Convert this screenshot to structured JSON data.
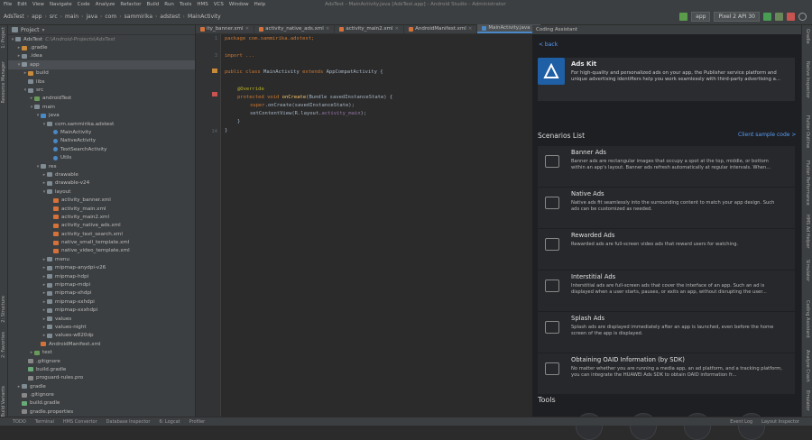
{
  "menubar": {
    "items": [
      "File",
      "Edit",
      "View",
      "Navigate",
      "Code",
      "Analyze",
      "Refactor",
      "Build",
      "Run",
      "Tools",
      "HMS",
      "VCS",
      "Window",
      "Help"
    ],
    "title": "AdsTest - MainActivity.java [AdsTest.app] - Android Studio - Administrator"
  },
  "breadcrumb": [
    "AdsTest",
    "app",
    "src",
    "main",
    "java",
    "com",
    "sammirika",
    "adstest",
    "MainActivity"
  ],
  "toolbar": {
    "module": "app",
    "device": "Pixel 2 API 30"
  },
  "left_strip": [
    "1: Project",
    "Resource Manager",
    "2: Structure",
    "2: Favorites",
    "Build Variants"
  ],
  "right_strip": [
    "Gradle",
    "Native Inspector",
    "Flutter Outline",
    "Flutter Performance",
    "HMS Ad Helper",
    "Simulator",
    "Coding Assistant",
    "Analyze Crash",
    "Emulator"
  ],
  "project": {
    "header": "Project",
    "rows": [
      {
        "indent": 0,
        "arrow": "▾",
        "label": "AdsTest",
        "note": "C:\\Android-Projects\\AdsTest",
        "icon": "folder",
        "color": "#7f8c93"
      },
      {
        "indent": 1,
        "arrow": "▸",
        "label": ".gradle",
        "icon": "folder",
        "color": "#c98a3a"
      },
      {
        "indent": 1,
        "arrow": "▸",
        "label": ".idea",
        "icon": "folder",
        "color": "#7f8c93"
      },
      {
        "indent": 1,
        "arrow": "▾",
        "label": "app",
        "icon": "folder",
        "color": "#87939a",
        "sel": true
      },
      {
        "indent": 2,
        "arrow": "▸",
        "label": "build",
        "icon": "folder",
        "color": "#c98a3a"
      },
      {
        "indent": 2,
        "arrow": "",
        "label": "libs",
        "icon": "folder",
        "color": "#7f8c93"
      },
      {
        "indent": 2,
        "arrow": "▾",
        "label": "src",
        "icon": "folder",
        "color": "#7f8c93"
      },
      {
        "indent": 3,
        "arrow": "▸",
        "label": "androidTest",
        "icon": "folder",
        "color": "#6a9a5a"
      },
      {
        "indent": 3,
        "arrow": "▾",
        "label": "main",
        "icon": "folder",
        "color": "#7f8c93"
      },
      {
        "indent": 4,
        "arrow": "▾",
        "label": "java",
        "icon": "folder",
        "color": "#4a88c7"
      },
      {
        "indent": 5,
        "arrow": "▾",
        "label": "com.sammirika.adstest",
        "icon": "folder",
        "color": "#7f8c93"
      },
      {
        "indent": 6,
        "arrow": "",
        "label": "MainActivity",
        "icon": "class",
        "color": "#4a88c7"
      },
      {
        "indent": 6,
        "arrow": "",
        "label": "NativeActivity",
        "icon": "class",
        "color": "#4a88c7"
      },
      {
        "indent": 6,
        "arrow": "",
        "label": "TextSearchActivity",
        "icon": "class",
        "color": "#4a88c7"
      },
      {
        "indent": 6,
        "arrow": "",
        "label": "Utils",
        "icon": "class",
        "color": "#4a88c7"
      },
      {
        "indent": 4,
        "arrow": "▾",
        "label": "res",
        "icon": "folder",
        "color": "#7f8c93"
      },
      {
        "indent": 5,
        "arrow": "▸",
        "label": "drawable",
        "icon": "folder",
        "color": "#7f8c93"
      },
      {
        "indent": 5,
        "arrow": "▸",
        "label": "drawable-v24",
        "icon": "folder",
        "color": "#7f8c93"
      },
      {
        "indent": 5,
        "arrow": "▾",
        "label": "layout",
        "icon": "folder",
        "color": "#7f8c93"
      },
      {
        "indent": 6,
        "arrow": "",
        "label": "activity_banner.xml",
        "icon": "xml",
        "color": "#d5723a"
      },
      {
        "indent": 6,
        "arrow": "",
        "label": "activity_main.xml",
        "icon": "xml",
        "color": "#d5723a"
      },
      {
        "indent": 6,
        "arrow": "",
        "label": "activity_main2.xml",
        "icon": "xml",
        "color": "#d5723a"
      },
      {
        "indent": 6,
        "arrow": "",
        "label": "activity_native_ads.xml",
        "icon": "xml",
        "color": "#d5723a"
      },
      {
        "indent": 6,
        "arrow": "",
        "label": "activity_text_search.xml",
        "icon": "xml",
        "color": "#d5723a"
      },
      {
        "indent": 6,
        "arrow": "",
        "label": "native_small_template.xml",
        "icon": "xml",
        "color": "#d5723a"
      },
      {
        "indent": 6,
        "arrow": "",
        "label": "native_video_template.xml",
        "icon": "xml",
        "color": "#d5723a"
      },
      {
        "indent": 5,
        "arrow": "▸",
        "label": "menu",
        "icon": "folder",
        "color": "#7f8c93"
      },
      {
        "indent": 5,
        "arrow": "▸",
        "label": "mipmap-anydpi-v26",
        "icon": "folder",
        "color": "#7f8c93"
      },
      {
        "indent": 5,
        "arrow": "▸",
        "label": "mipmap-hdpi",
        "icon": "folder",
        "color": "#7f8c93"
      },
      {
        "indent": 5,
        "arrow": "▸",
        "label": "mipmap-mdpi",
        "icon": "folder",
        "color": "#7f8c93"
      },
      {
        "indent": 5,
        "arrow": "▸",
        "label": "mipmap-xhdpi",
        "icon": "folder",
        "color": "#7f8c93"
      },
      {
        "indent": 5,
        "arrow": "▸",
        "label": "mipmap-xxhdpi",
        "icon": "folder",
        "color": "#7f8c93"
      },
      {
        "indent": 5,
        "arrow": "▸",
        "label": "mipmap-xxxhdpi",
        "icon": "folder",
        "color": "#7f8c93"
      },
      {
        "indent": 5,
        "arrow": "▸",
        "label": "values",
        "icon": "folder",
        "color": "#7f8c93"
      },
      {
        "indent": 5,
        "arrow": "▸",
        "label": "values-night",
        "icon": "folder",
        "color": "#7f8c93"
      },
      {
        "indent": 5,
        "arrow": "▸",
        "label": "values-w820dp",
        "icon": "folder",
        "color": "#7f8c93"
      },
      {
        "indent": 4,
        "arrow": "",
        "label": "AndroidManifest.xml",
        "icon": "xml",
        "color": "#d5723a"
      },
      {
        "indent": 3,
        "arrow": "▸",
        "label": "test",
        "icon": "folder",
        "color": "#6a9a5a"
      },
      {
        "indent": 2,
        "arrow": "",
        "label": ".gitignore",
        "icon": "file",
        "color": "#888888"
      },
      {
        "indent": 2,
        "arrow": "",
        "label": "build.gradle",
        "icon": "file",
        "color": "#6aaa78"
      },
      {
        "indent": 2,
        "arrow": "",
        "label": "proguard-rules.pro",
        "icon": "file",
        "color": "#888888"
      },
      {
        "indent": 1,
        "arrow": "▸",
        "label": "gradle",
        "icon": "folder",
        "color": "#7f8c93"
      },
      {
        "indent": 1,
        "arrow": "",
        "label": ".gitignore",
        "icon": "file",
        "color": "#888888"
      },
      {
        "indent": 1,
        "arrow": "",
        "label": "build.gradle",
        "icon": "file",
        "color": "#6aaa78"
      },
      {
        "indent": 1,
        "arrow": "",
        "label": "gradle.properties",
        "icon": "file",
        "color": "#888888"
      }
    ]
  },
  "tabs": [
    {
      "label": "ity_banner.xml",
      "color": "#d5723a"
    },
    {
      "label": "activity_native_ads.xml",
      "color": "#d5723a"
    },
    {
      "label": "activity_main2.xml",
      "color": "#d5723a"
    },
    {
      "label": "AndroidManifest.xml",
      "color": "#d5723a"
    },
    {
      "label": "MainActivity.java",
      "color": "#4a88c7",
      "active": true
    }
  ],
  "code": {
    "lines": [
      "1",
      "2",
      "3",
      "",
      "",
      "",
      "",
      "",
      "",
      "",
      "",
      "",
      "",
      "14"
    ],
    "package": "package com.sammirika.adstest;",
    "import": "import ...",
    "class_decl_kw": "public class ",
    "class_name": "MainActivity ",
    "class_ext_kw": "extends ",
    "class_rest": "AppCompatActivity {",
    "override": "@Override",
    "method_kw": "protected void ",
    "method_name": "onCreate",
    "method_rest": "(Bundle savedInstanceState) {",
    "super_call_kw": "super",
    "super_call_rest": ".onCreate(savedInstanceState);",
    "setview_pre": "setContentView(R.layout.",
    "setview_field": "activity_main",
    "setview_post": ");",
    "close_inner": "}",
    "close_outer": "}"
  },
  "assistant": {
    "header": "Coding Assistant",
    "back": "< back",
    "kit_name": "Ads Kit",
    "kit_desc": "For high-quality and personalized ads on your app, the Publisher service platform and unique advertising identifiers help you work seamlessly with third-party advertising a...",
    "scenarios_title": "Scenarios List",
    "client_link": "Client sample code >",
    "scenarios": [
      {
        "title": "Banner Ads",
        "desc": "Banner ads are rectangular images that occupy a spot at the top, middle, or bottom within an app's layout. Banner ads refresh automatically at regular intervals. When..."
      },
      {
        "title": "Native Ads",
        "desc": "Native ads fit seamlessly into the surrounding content to match your app design. Such ads can be customized as needed."
      },
      {
        "title": "Rewarded Ads",
        "desc": "Rewarded ads are full-screen video ads that reward users for watching."
      },
      {
        "title": "Interstitial Ads",
        "desc": "Interstitial ads are full-screen ads that cover the interface of an app. Such an ad is displayed when a user starts, pauses, or exits an app, without disrupting the user..."
      },
      {
        "title": "Splash Ads",
        "desc": "Splash ads are displayed immediately after an app is launched, even before the home screen of the app is displayed."
      },
      {
        "title": "Obtaining OAID Information (by SDK)",
        "desc": "No matter whether you are running a media app, an ad platform, and a tracking platform, you can integrate the HUAWEI Ads SDK to obtain OAID information fr..."
      }
    ],
    "tools_title": "Tools"
  },
  "statusbar": [
    "TODO",
    "Terminal",
    "HMS Convertor",
    "Database Inspector",
    "6: Logcat",
    "Profiler",
    "Event Log",
    "Layout Inspector"
  ]
}
